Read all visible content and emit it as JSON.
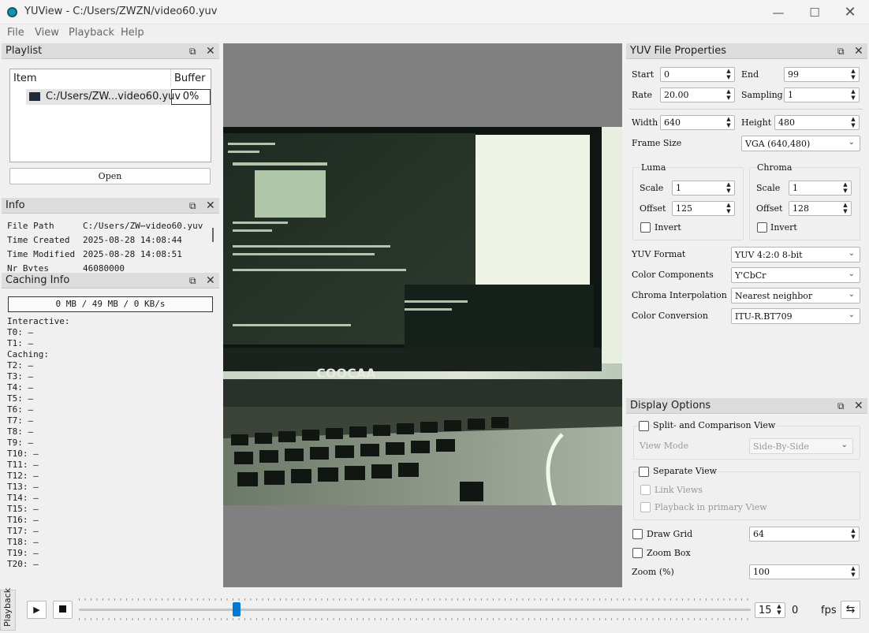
{
  "window": {
    "title": "YUView - C:/Users/ZWZN/video60.yuv"
  },
  "menu": [
    "File",
    "View",
    "Playback",
    "Help"
  ],
  "playlist": {
    "title": "Playlist",
    "col_item": "Item",
    "col_buffer": "Buffer",
    "items": [
      {
        "name": "C:/Users/ZW...video60.yuv",
        "buffer": "0%"
      }
    ],
    "open_label": "Open"
  },
  "info": {
    "title": "Info",
    "rows": [
      {
        "k": "File Path",
        "v": "C:/Users/ZW⋯video60.yuv"
      },
      {
        "k": "Time Created",
        "v": "2025-08-28 14:08:44"
      },
      {
        "k": "Time Modified",
        "v": "2025-08-28 14:08:51"
      },
      {
        "k": "Nr Bytes",
        "v": "46080000"
      }
    ]
  },
  "caching": {
    "title": "Caching Info",
    "summary": "0 MB / 49 MB / 0 KB/s",
    "interactive_label": "Interactive:",
    "interactive": [
      "T0: –",
      "T1: –"
    ],
    "caching_label": "Caching:",
    "threads": [
      "T2: –",
      "T3: –",
      "T4: –",
      "T5: –",
      "T6: –",
      "T7: –",
      "T8: –",
      "T9: –",
      "T10: –",
      "T11: –",
      "T12: –",
      "T13: –",
      "T14: –",
      "T15: –",
      "T16: –",
      "T17: –",
      "T18: –",
      "T19: –",
      "T20: –"
    ]
  },
  "yuv": {
    "title": "YUV File Properties",
    "start_label": "Start",
    "start": "0",
    "end_label": "End",
    "end": "99",
    "rate_label": "Rate",
    "rate": "20.00",
    "sampling_label": "Sampling",
    "sampling": "1",
    "width_label": "Width",
    "width": "640",
    "height_label": "Height",
    "height": "480",
    "framesize_label": "Frame Size",
    "framesize": "VGA (640,480)",
    "luma": {
      "title": "Luma",
      "scale_label": "Scale",
      "scale": "1",
      "offset_label": "Offset",
      "offset": "125",
      "invert_label": "Invert"
    },
    "chroma": {
      "title": "Chroma",
      "scale_label": "Scale",
      "scale": "1",
      "offset_label": "Offset",
      "offset": "128",
      "invert_label": "Invert"
    },
    "format_label": "YUV Format",
    "format": "YUV 4:2:0 8-bit",
    "components_label": "Color Components",
    "components": "Y'CbCr",
    "interp_label": "Chroma Interpolation",
    "interp": "Nearest neighbor",
    "conversion_label": "Color Conversion",
    "conversion": "ITU-R.BT709"
  },
  "display": {
    "title": "Display Options",
    "split_label": "Split- and Comparison View",
    "viewmode_label": "View Mode",
    "viewmode": "Side-By-Side",
    "separate_label": "Separate View",
    "link_label": "Link Views",
    "primary_label": "Playback in primary View",
    "grid_label": "Draw Grid",
    "grid": "64",
    "zoombox_label": "Zoom Box",
    "zoom_label": "Zoom (%)",
    "zoom": "100"
  },
  "playback": {
    "tab_label": "Playback",
    "fps": "15",
    "frame": "0",
    "fps_label": "fps",
    "progress": 0.232
  },
  "colors": {
    "accent": "#0078d4",
    "viewer_bg": "#808080"
  }
}
